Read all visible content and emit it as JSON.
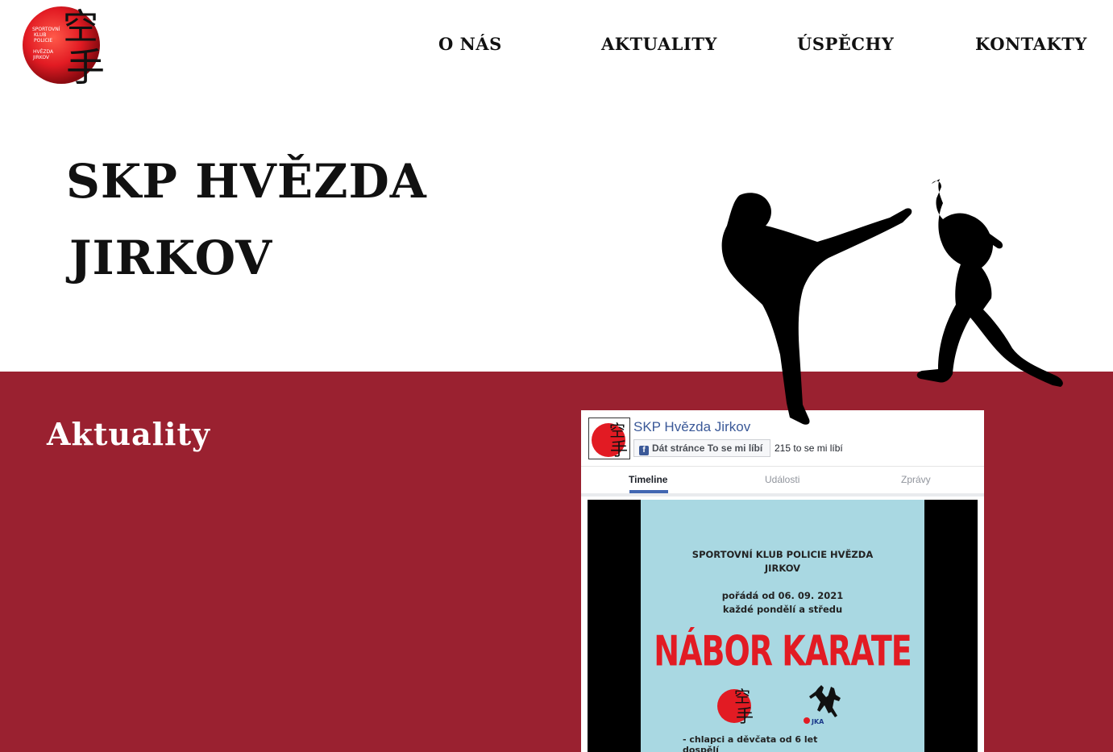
{
  "header": {
    "logo_icon": "karate-club-logo",
    "logo_text": "SPORTOVNÍ KLUB POLICIE HVĚZDA JIRKOV",
    "logo_kanji": "空手",
    "nav": [
      "O NÁS",
      "AKTUALITY",
      "ÚSPĚCHY",
      "KONTAKTY"
    ]
  },
  "hero": {
    "title_line1": "SKP HVĚZDA",
    "title_line2": "JIRKOV",
    "image_icon": "karate-fighters-silhouette"
  },
  "news": {
    "title": "Aktuality"
  },
  "facebook": {
    "page_name": "SKP Hvězda Jirkov",
    "like_button": "Dát stránce To se mi líbí",
    "like_count": "215 to se mi líbí",
    "tabs": [
      "Timeline",
      "Události",
      "Zprávy"
    ],
    "active_tab": "Timeline",
    "post": {
      "org_line1": "SPORTOVNÍ KLUB POLICIE HVĚZDA",
      "org_line2": "JIRKOV",
      "date_line1": "pořádá od 06. 09. 2021",
      "date_line2": "každé pondělí a středu",
      "headline": "NÁBOR KARATE",
      "bullet": "-  chlapci a děvčata od 6 let",
      "bullet2": "   dospělí"
    }
  },
  "colors": {
    "brand_red": "#9a2130",
    "logo_red": "#e21b23",
    "facebook_blue": "#3b5998",
    "poster_blue": "#a9d8e2"
  }
}
